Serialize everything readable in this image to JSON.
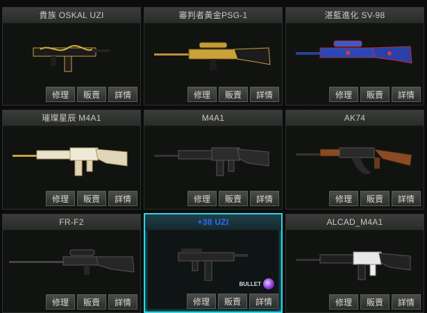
{
  "weapons": [
    {
      "title": "貴族 OSKAL UZI",
      "icon": "gold-uzi"
    },
    {
      "title": "審判者黃金PSG-1",
      "icon": "gold-sniper-rifle"
    },
    {
      "title": "湛藍進化 SV-98",
      "icon": "blue-sniper-rifle"
    },
    {
      "title": "璀璨星辰 M4A1",
      "icon": "jeweled-rifle"
    },
    {
      "title": "M4A1",
      "icon": "rifle"
    },
    {
      "title": "AK74",
      "icon": "ak-rifle"
    },
    {
      "title": "FR-F2",
      "icon": "sniper-rifle"
    },
    {
      "title": "+38 UZI",
      "icon": "uzi"
    },
    {
      "title": "ALCAD_M4A1",
      "icon": "white-rifle"
    }
  ],
  "buttons": {
    "repair": "修理",
    "sell": "販賣",
    "details": "詳情"
  },
  "badge": {
    "bullet": "BULLET"
  },
  "colors": {
    "selected_border": "#2fd6e6",
    "selected_title": "#2a6cff"
  }
}
